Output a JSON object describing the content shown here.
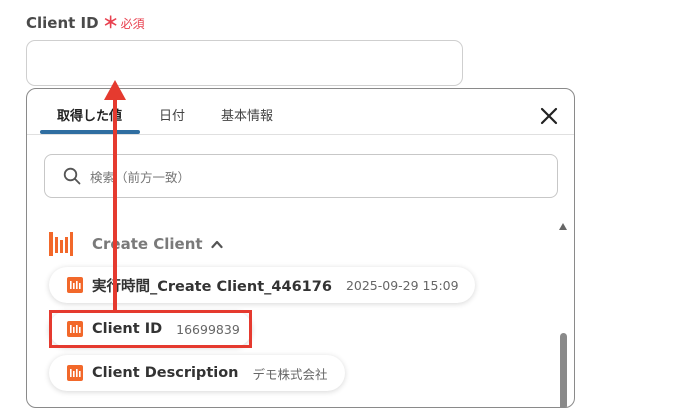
{
  "field": {
    "label": "Client ID",
    "required_mark": "＊",
    "required_text": "必須",
    "value": ""
  },
  "panel": {
    "tabs": [
      {
        "label": "取得した値",
        "active": true
      },
      {
        "label": "日付",
        "active": false
      },
      {
        "label": "基本情報",
        "active": false
      }
    ],
    "search_placeholder": "検索（前方一致）",
    "group": {
      "title": "Create Client",
      "expanded": true,
      "icon": "app-logo-icon"
    },
    "items": [
      {
        "label": "実行時間_Create Client_446176",
        "value": "2025-09-29 15:09"
      },
      {
        "label": "Client ID",
        "value": "16699839"
      },
      {
        "label": "Client Description",
        "value": "デモ株式会社"
      }
    ]
  },
  "colors": {
    "accent": "#2f6ea1",
    "required": "#e8414f",
    "annotation": "#e53a2f",
    "app_icon": "#f2682a"
  },
  "icons": {
    "close": "close-icon",
    "search": "search-icon",
    "chevron": "chevron-up-icon"
  }
}
